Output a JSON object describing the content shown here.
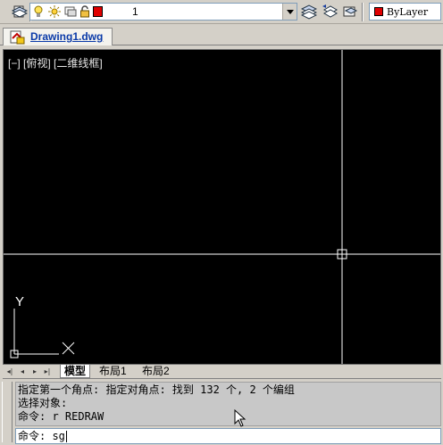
{
  "layer_toolbar": {
    "current_layer": "1",
    "layer_color": "#e00000",
    "icons": [
      "layer-properties-icon",
      "lightbulb-icon",
      "sun-icon",
      "layer-color-icon",
      "lock-icon",
      "make-current-layer-icon",
      "layer-previous-icon",
      "layer-states-icon"
    ]
  },
  "properties_toolbar": {
    "color_label": "ByLayer",
    "color_swatch": "#e00000"
  },
  "document_tab": {
    "label": "Drawing1.dwg"
  },
  "viewport": {
    "label": "[−] [俯视] [二维线框]",
    "background": "#000000",
    "axis_y_label": "Y",
    "crosshair_color": "#ffffff"
  },
  "layout_tabs": {
    "items": [
      "模型",
      "布局1",
      "布局2"
    ],
    "active": "模型"
  },
  "command_window": {
    "history": [
      "指定第一个角点: 指定对角点: 找到 132 个, 2 个编组",
      "选择对象:",
      "命令: r REDRAW"
    ],
    "input": "命令: sg"
  }
}
